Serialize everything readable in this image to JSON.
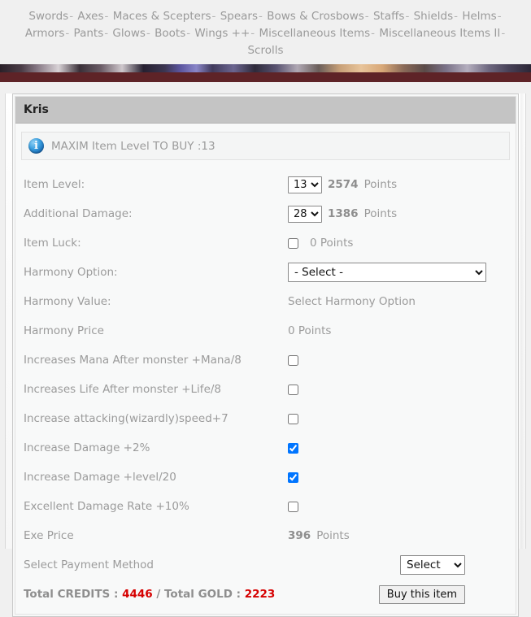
{
  "nav": {
    "line1": [
      "Swords",
      "Axes",
      "Maces & Scepters",
      "Spears",
      "Bows & Crosbows",
      "Staffs",
      "Shields",
      "Helms",
      "Armors",
      "Pants"
    ],
    "line2": [
      "Glows",
      "Boots",
      "Wings ++",
      "Miscellaneous Items",
      "Miscellaneous Items II",
      "Scrolls"
    ],
    "separator": "-"
  },
  "panel": {
    "title": "Kris",
    "notice": {
      "icon": "info-icon",
      "text": "MAXIM Item Level TO BUY :13"
    }
  },
  "form": {
    "item_level": {
      "label": "Item Level:",
      "value": "13",
      "points": "2574",
      "points_unit": "Points"
    },
    "additional_damage": {
      "label": "Additional Damage:",
      "value": "28",
      "points": "1386",
      "points_unit": "Points"
    },
    "item_luck": {
      "label": "Item Luck:",
      "checked": false,
      "points": "0 Points"
    },
    "harmony_option": {
      "label": "Harmony Option:",
      "value": "- Select -"
    },
    "harmony_value": {
      "label": "Harmony Value:",
      "value": "Select Harmony Option"
    },
    "harmony_price": {
      "label": "Harmony Price",
      "value": "0 Points"
    },
    "options": [
      {
        "label": "Increases Mana After monster +Mana/8",
        "checked": false
      },
      {
        "label": "Increases Life After monster +Life/8",
        "checked": false
      },
      {
        "label": "Increase attacking(wizardly)speed+7",
        "checked": false
      },
      {
        "label": "Increase Damage +2%",
        "checked": true
      },
      {
        "label": "Increase Damage +level/20",
        "checked": true
      },
      {
        "label": "Excellent Damage Rate +10%",
        "checked": false
      }
    ],
    "exe_price": {
      "label": "Exe Price",
      "points": "396",
      "points_unit": "Points"
    },
    "payment": {
      "label": "Select Payment Method",
      "value": "Select"
    },
    "totals": {
      "credits_label": "Total CREDITS : ",
      "credits_value": "4446",
      "middle": " / ",
      "gold_label": "Total GOLD : ",
      "gold_value": "2223"
    },
    "buy_button": "Buy this item"
  },
  "colors": {
    "accent_red": "#d60000",
    "banner_bar": "#5e2327",
    "panel_header": "#c4c4c4",
    "muted_text": "#9b9b9b"
  }
}
